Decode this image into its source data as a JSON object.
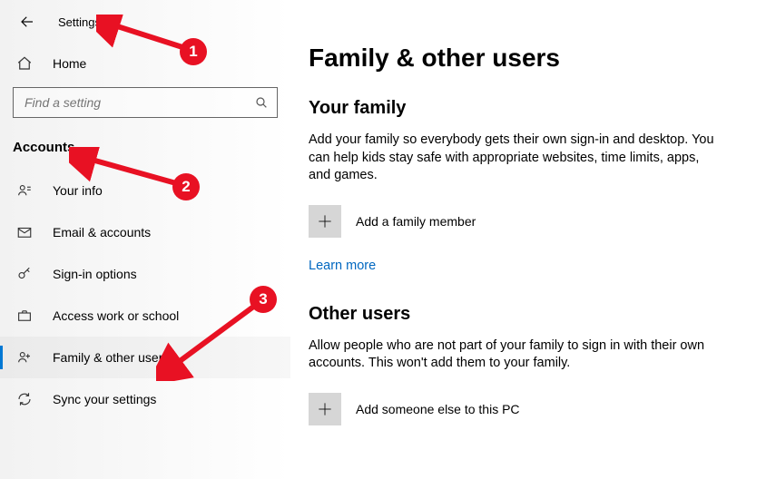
{
  "header": {
    "title": "Settings"
  },
  "sidebar": {
    "home_label": "Home",
    "search_placeholder": "Find a setting",
    "section_title": "Accounts",
    "items": [
      {
        "label": "Your info"
      },
      {
        "label": "Email & accounts"
      },
      {
        "label": "Sign-in options"
      },
      {
        "label": "Access work or school"
      },
      {
        "label": "Family & other users"
      },
      {
        "label": "Sync your settings"
      }
    ]
  },
  "main": {
    "title": "Family & other users",
    "family_heading": "Your family",
    "family_body": "Add your family so everybody gets their own sign-in and desktop. You can help kids stay safe with appropriate websites, time limits, apps, and games.",
    "add_family_label": "Add a family member",
    "learn_more": "Learn more",
    "other_heading": "Other users",
    "other_body": "Allow people who are not part of your family to sign in with their own accounts. This won't add them to your family.",
    "add_other_label": "Add someone else to this PC"
  },
  "annotations": {
    "one": "1",
    "two": "2",
    "three": "3"
  }
}
